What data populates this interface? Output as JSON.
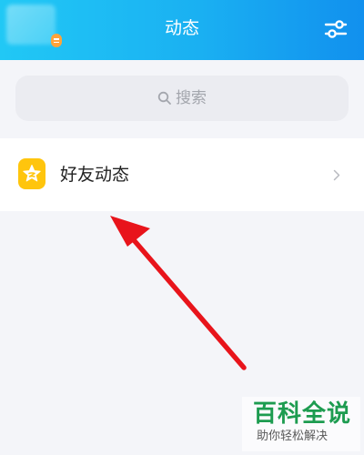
{
  "header": {
    "title": "动态",
    "background_start": "#21c8f5",
    "background_end": "#1190ee",
    "avatar_badge_color": "#ffa33a",
    "settings_icon": "sliders-icon"
  },
  "search": {
    "placeholder": "搜索",
    "icon": "search-icon"
  },
  "list": {
    "items": [
      {
        "label": "好友动态",
        "icon": "star-icon",
        "icon_color": "#ffc50d",
        "trailing_icon": "chevron-right-icon"
      }
    ]
  },
  "annotation": {
    "type": "arrow",
    "color": "#e8141b"
  },
  "watermark": {
    "title": "百科全说",
    "subtitle": "助你轻松解决"
  }
}
